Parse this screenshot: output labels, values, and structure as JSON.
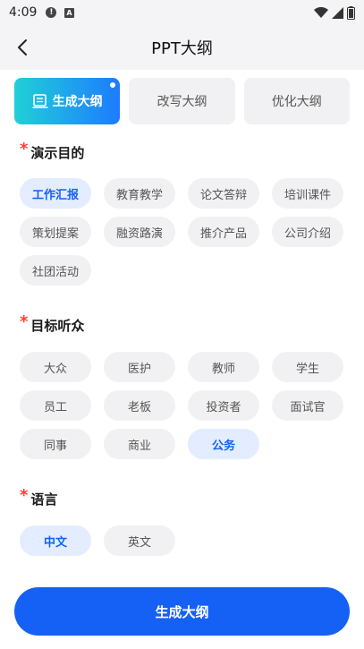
{
  "status_bar": {
    "time": "4:09",
    "alert_glyph": "!",
    "a_glyph": "A"
  },
  "header": {
    "title": "PPT大纲"
  },
  "tabs": [
    {
      "label": "生成大纲",
      "active": true
    },
    {
      "label": "改写大纲",
      "active": false
    },
    {
      "label": "优化大纲",
      "active": false
    }
  ],
  "purpose": {
    "title": "演示目的",
    "required_mark": "*",
    "options": [
      "工作汇报",
      "教育教学",
      "论文答辩",
      "培训课件",
      "策划提案",
      "融资路演",
      "推介产品",
      "公司介绍",
      "社团活动"
    ],
    "selected": "工作汇报"
  },
  "audience": {
    "title": "目标听众",
    "required_mark": "*",
    "options": [
      "大众",
      "医护",
      "教师",
      "学生",
      "员工",
      "老板",
      "投资者",
      "面试官",
      "同事",
      "商业",
      "公务"
    ],
    "selected": "公务"
  },
  "language": {
    "title": "语言",
    "required_mark": "*",
    "options": [
      "中文",
      "英文"
    ],
    "selected": "中文"
  },
  "footer": {
    "generate_label": "生成大纲"
  },
  "colors": {
    "accent": "#1561f5",
    "selected_bg": "#e3edff",
    "required": "#ff3b30",
    "tab_gradient_start": "#20d0d6",
    "tab_gradient_end": "#1e7bff"
  }
}
